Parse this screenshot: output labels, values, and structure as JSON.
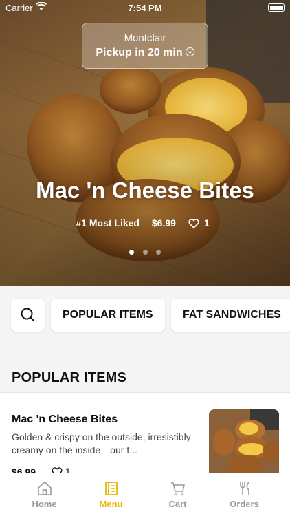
{
  "status_bar": {
    "carrier": "Carrier",
    "time": "7:54 PM"
  },
  "location": {
    "city": "Montclair",
    "pickup": "Pickup in 20 min"
  },
  "hero": {
    "title": "Mac 'n Cheese Bites",
    "rank": "#1 Most Liked",
    "price": "$6.99",
    "likes": "1",
    "slide_count": 3,
    "active_slide": 1
  },
  "categories": {
    "search_icon": "search-icon",
    "items": [
      "POPULAR ITEMS",
      "FAT SANDWICHES"
    ]
  },
  "section": {
    "title": "POPULAR ITEMS"
  },
  "menu_item": {
    "name": "Mac 'n Cheese Bites",
    "description": "Golden & crispy on the outside, irresistibly creamy on the inside—our f...",
    "price": "$6.99",
    "likes": "1"
  },
  "tab_bar": {
    "tabs": [
      {
        "label": "Home",
        "icon": "home-icon"
      },
      {
        "label": "Menu",
        "icon": "menu-icon"
      },
      {
        "label": "Cart",
        "icon": "cart-icon"
      },
      {
        "label": "Orders",
        "icon": "fork-knife-icon"
      }
    ],
    "active_index": 1,
    "accent_color": "#e8b800"
  }
}
